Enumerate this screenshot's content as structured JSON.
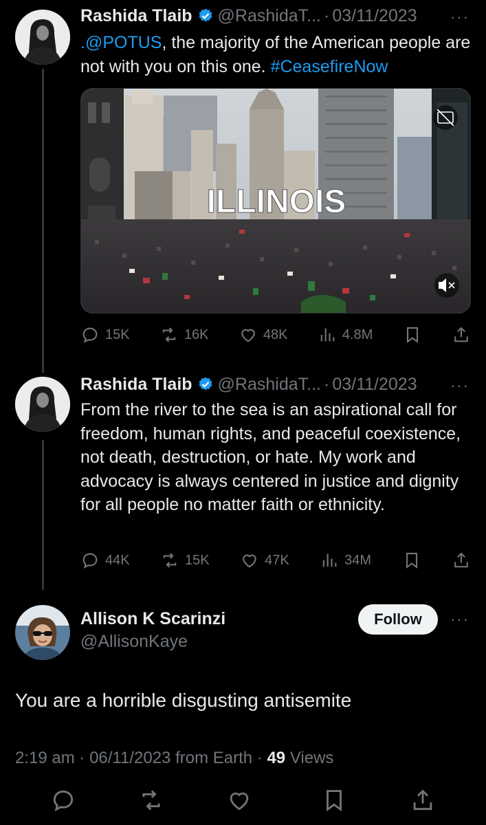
{
  "tweets": [
    {
      "name": "Rashida Tlaib",
      "handle": "@RashidaT...",
      "date": "03/11/2023",
      "text_mention": ".@POTUS",
      "text_body": ", the majority of the American people are not with you on this one. ",
      "text_hashtag": "#CeasefireNow",
      "media": {
        "overlay_text": "ILLINOIS",
        "cc_icon": "closed-captions-icon",
        "mute_icon": "mute-icon"
      },
      "stats": {
        "replies": "15K",
        "reposts": "16K",
        "likes": "48K",
        "views": "4.8M"
      }
    },
    {
      "name": "Rashida Tlaib",
      "handle": "@RashidaT...",
      "date": "03/11/2023",
      "text": "From the river to the sea is an aspirational call for freedom, human rights, and peaceful coexistence, not death, destruction, or hate. My work and advocacy is always centered in justice and dignity for all people no matter faith or ethnicity.",
      "stats": {
        "replies": "44K",
        "reposts": "15K",
        "likes": "47K",
        "views": "34M"
      }
    }
  ],
  "reply": {
    "name": "Allison K Scarinzi",
    "handle": "@AllisonKaye",
    "follow_label": "Follow",
    "text": "You are a horrible disgusting antisemite",
    "time": "2:19 am",
    "date": "06/11/2023",
    "source": "from Earth",
    "views_count": "49",
    "views_label": "Views"
  },
  "more_label": "···",
  "separator": "·",
  "colors": {
    "background": "#000000",
    "text": "#e7e9ea",
    "muted": "#71767b",
    "link": "#1d9bf0",
    "verified": "#1d9bf0"
  },
  "icons": [
    "reply-icon",
    "repost-icon",
    "like-icon",
    "views-icon",
    "bookmark-icon",
    "share-icon",
    "verified-badge-icon",
    "more-icon"
  ]
}
